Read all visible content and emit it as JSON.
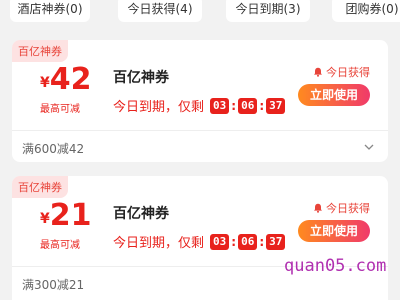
{
  "tabs": [
    {
      "label": "酒店神券(0)"
    },
    {
      "label": "今日获得(4)"
    },
    {
      "label": "今日到期(3)"
    },
    {
      "label": "团购券(0)"
    }
  ],
  "coupons": [
    {
      "tag": "百亿神券",
      "currency": "¥",
      "amount": "42",
      "max_label": "最高可减",
      "title": "百亿神券",
      "expire_text": "今日到期，仅剩",
      "timer": {
        "h": "03",
        "m": "06",
        "s": "37"
      },
      "gotten_text": "今日获得",
      "use_button": "立即使用",
      "rule": "满600减42"
    },
    {
      "tag": "百亿神券",
      "currency": "¥",
      "amount": "21",
      "max_label": "最高可减",
      "title": "百亿神券",
      "expire_text": "今日到期，仅剩",
      "timer": {
        "h": "03",
        "m": "06",
        "s": "37"
      },
      "gotten_text": "今日获得",
      "use_button": "立即使用",
      "rule": "满300减21"
    }
  ],
  "watermark": "quan05.com",
  "colors": {
    "accent_red": "#e8221c",
    "tag_bg": "#fde2e2",
    "button_gradient_start": "#ff8a1f",
    "button_gradient_end": "#f03a6a",
    "watermark": "#b030b0"
  },
  "icons": {
    "gotten": "bell-icon",
    "expand": "chevron-down-icon"
  }
}
